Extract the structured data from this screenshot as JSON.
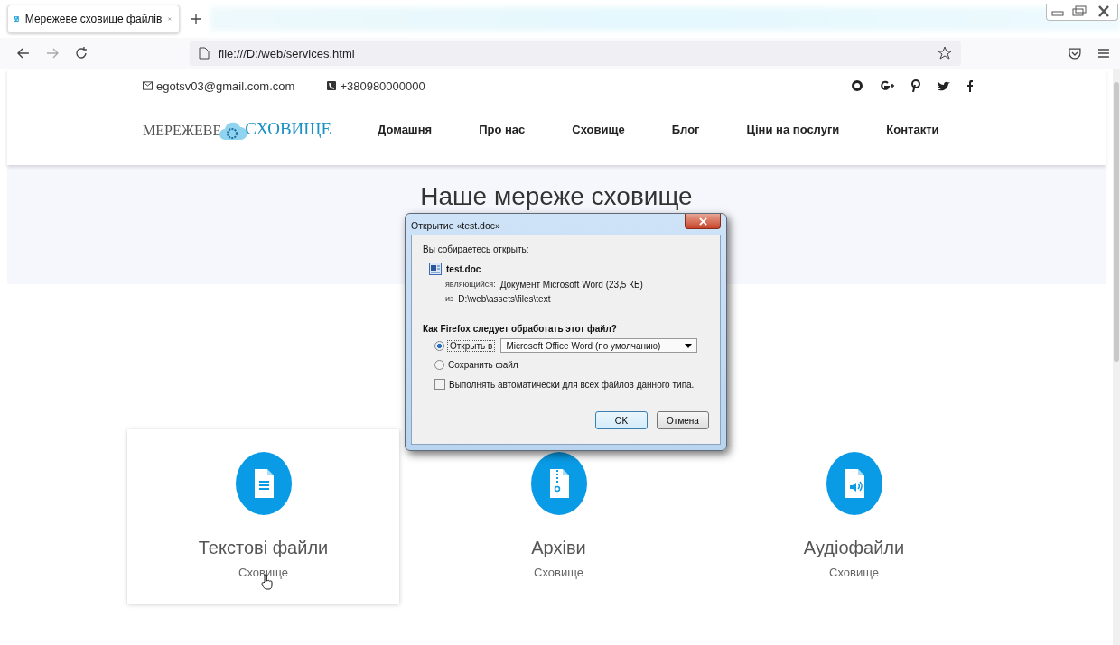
{
  "browser": {
    "tab": {
      "title": "Мережеве сховище файлів",
      "selected": true
    },
    "address": "file:///D:/web/services.html"
  },
  "topbar": {
    "email": "egotsv03@gmail.com.com",
    "phone": "+380980000000"
  },
  "logo": {
    "left": "МЕРЕЖЕВЕ",
    "right": "СХОВИЩЕ"
  },
  "nav": [
    {
      "label": "Домашня"
    },
    {
      "label": "Про нас"
    },
    {
      "label": "Сховище"
    },
    {
      "label": "Блог"
    },
    {
      "label": "Ціни на послуги"
    },
    {
      "label": "Контакти"
    }
  ],
  "hero": {
    "title": "Наше мереже сховище"
  },
  "cards": [
    {
      "kind": "text",
      "title": "Текстові файли",
      "subtitle": "Сховище",
      "hovered": true
    },
    {
      "kind": "archive",
      "title": "Архіви",
      "subtitle": "Сховище",
      "hovered": false
    },
    {
      "kind": "audio",
      "title": "Аудіофайли",
      "subtitle": "Сховище",
      "hovered": false
    }
  ],
  "dialog": {
    "title": "Открытие «test.doc»",
    "intro": "Вы собираетесь открыть:",
    "file_name": "test.doc",
    "type_label": "являющийся:",
    "type_value": "Документ Microsoft Word (23,5 КБ)",
    "from_label": "из",
    "from_value": "D:\\web\\assets\\files\\text",
    "question": "Как Firefox следует обработать этот файл?",
    "options": [
      {
        "kind": "open",
        "label": "Открыть в",
        "selected": true,
        "app": "Microsoft Office Word (по умолчанию)"
      },
      {
        "kind": "save",
        "label": "Сохранить файл",
        "selected": false
      }
    ],
    "auto": {
      "label": "Выполнять автоматически для всех файлов данного типа.",
      "checked": false
    },
    "buttons": [
      "OK",
      "Отмена"
    ]
  }
}
